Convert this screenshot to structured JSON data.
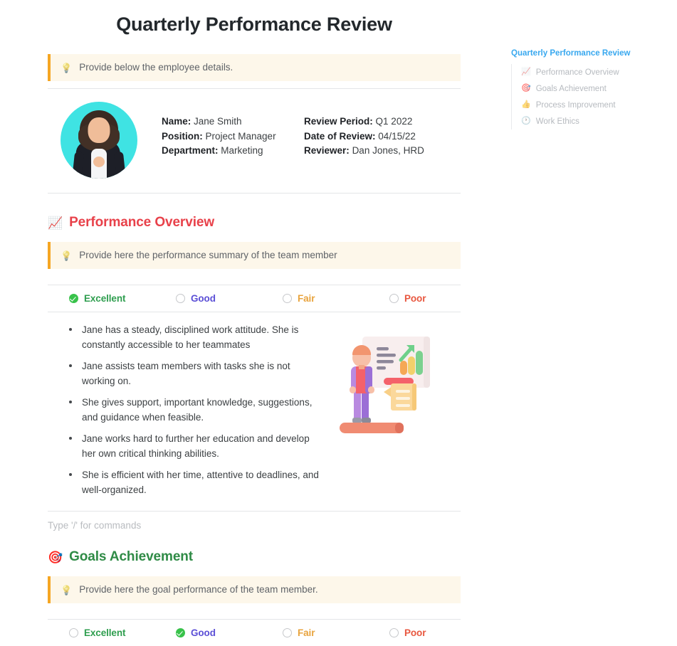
{
  "document": {
    "title": "Quarterly Performance Review"
  },
  "intro_callout": {
    "icon": "lightbulb-icon",
    "text": "Provide below the employee details."
  },
  "employee": {
    "avatar_alt": "Employee portrait photo",
    "left_fields": [
      {
        "label": "Name:",
        "value": "Jane Smith"
      },
      {
        "label": "Position:",
        "value": "Project Manager"
      },
      {
        "label": "Department:",
        "value": "Marketing"
      }
    ],
    "right_fields": [
      {
        "label": "Review Period:",
        "value": "Q1 2022"
      },
      {
        "label": "Date of Review:",
        "value": "04/15/22"
      },
      {
        "label": "Reviewer:",
        "value": "Dan Jones, HRD"
      }
    ]
  },
  "performance_overview": {
    "emoji": "chart-increasing-icon",
    "heading": "Performance Overview",
    "callout": {
      "icon": "lightbulb-icon",
      "text": "Provide here the performance summary of the team member"
    },
    "ratings": [
      {
        "label": "Excellent",
        "selected": true,
        "color": "#2f9e4f"
      },
      {
        "label": "Good",
        "selected": false,
        "color": "#5b4fd6"
      },
      {
        "label": "Fair",
        "selected": false,
        "color": "#e8a33d"
      },
      {
        "label": "Poor",
        "selected": false,
        "color": "#e8573f"
      }
    ],
    "bullets": [
      "Jane has a steady, disciplined work attitude. She is constantly accessible to her teammates",
      "Jane assists team members with tasks she is not working on.",
      "She gives support, important knowledge, suggestions, and guidance when feasible.",
      "Jane works hard to further her education and develop her own critical thinking abilities.",
      "She is efficient with her time, attentive to deadlines, and well-organized."
    ],
    "illustration_alt": "presenter-with-chart-board-illustration",
    "command_placeholder": "Type '/' for commands"
  },
  "goals_achievement": {
    "emoji": "bullseye-icon",
    "heading": "Goals Achievement",
    "callout": {
      "icon": "lightbulb-icon",
      "text": "Provide here the goal performance of the team member."
    },
    "ratings": [
      {
        "label": "Excellent",
        "selected": false,
        "color": "#2f9e4f"
      },
      {
        "label": "Good",
        "selected": true,
        "color": "#5b4fd6"
      },
      {
        "label": "Fair",
        "selected": false,
        "color": "#e8a33d"
      },
      {
        "label": "Poor",
        "selected": false,
        "color": "#e8573f"
      }
    ]
  },
  "toc": {
    "title": "Quarterly Performance Review",
    "title_color": "#38a8ef",
    "items": [
      {
        "emoji": "chart-increasing-icon",
        "label": "Performance Overview"
      },
      {
        "emoji": "bullseye-icon",
        "label": "Goals Achievement"
      },
      {
        "emoji": "thumbs-up-icon",
        "label": "Process Improvement"
      },
      {
        "emoji": "clock-icon",
        "label": "Work Ethics"
      }
    ]
  },
  "icons": {
    "lightbulb": "💡",
    "chart_increasing": "📈",
    "bullseye": "🎯",
    "thumbs_up": "👍",
    "clock": "🕐"
  }
}
